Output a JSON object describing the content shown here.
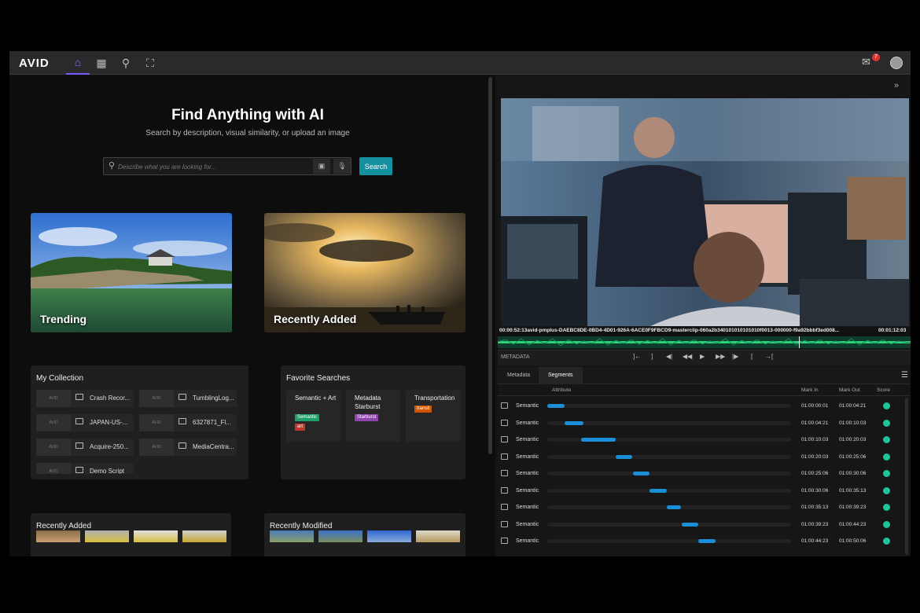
{
  "nav": {
    "logo": "AVID",
    "items": [
      {
        "name": "home",
        "glyph": "⌂"
      },
      {
        "name": "browse",
        "glyph": "▦"
      },
      {
        "name": "search",
        "glyph": "⚲"
      },
      {
        "name": "workflow",
        "glyph": "⛶"
      }
    ],
    "notification_count": "7"
  },
  "hero": {
    "title": "Find Anything with AI",
    "subtitle": "Search by description, visual similarity, or upload an image",
    "search_placeholder": "Describe what you are looking for...",
    "search_label": "Search"
  },
  "tiles": [
    {
      "label": "Trending"
    },
    {
      "label": "Recently Added"
    }
  ],
  "my_collection": {
    "title": "My Collection",
    "items": [
      "Crash Recor...",
      "TumblingLog...",
      "JAPAN-US-...",
      "6327871_Fl...",
      "Acquire-250...",
      "MediaCentra...",
      "Demo Script"
    ]
  },
  "favorite_searches": {
    "title": "Favorite Searches",
    "items": [
      {
        "label": "Semantic + Art",
        "chips": [
          {
            "text": "Semantic",
            "color": "#1f9d6a"
          },
          {
            "text": "art",
            "color": "#c0392b"
          }
        ]
      },
      {
        "label": "Metadata Starburst",
        "chips": [
          {
            "text": "Starburst",
            "color": "#8e44ad"
          }
        ]
      },
      {
        "label": "Transportation",
        "chips": [
          {
            "text": "transit",
            "color": "#d35400"
          }
        ]
      }
    ]
  },
  "recently_added": {
    "title": "Recently Added"
  },
  "recently_modified": {
    "title": "Recently Modified"
  },
  "player": {
    "timecode_start": "00:00:52:13",
    "clip_name": "avid-pmplus-DAEBC8DE-0BD4-4D01-926A-6ACE0F9FBCD9-masterclip-060a2b340101010101010f0013-000000-f9a92bbbf3ed008...",
    "timecode_end": "00:01:12:03",
    "panel_label": "METADATA"
  },
  "tabs": [
    {
      "label": "Metadata"
    },
    {
      "label": "Segments"
    }
  ],
  "segments": {
    "headers": {
      "attribute": "Attribute",
      "mark_in": "Mark In",
      "mark_out": "Mark Out",
      "score": "Score"
    },
    "rows": [
      {
        "type": "Semantic",
        "mark_in": "01:00:00:01",
        "mark_out": "01:00:04:21",
        "start": 0.0,
        "end": 0.07
      },
      {
        "type": "Semantic",
        "mark_in": "01:00:04:21",
        "mark_out": "01:00:10:03",
        "start": 0.07,
        "end": 0.15
      },
      {
        "type": "Semantic",
        "mark_in": "01:00:10:03",
        "mark_out": "01:00:20:03",
        "start": 0.14,
        "end": 0.28
      },
      {
        "type": "Semantic",
        "mark_in": "01:00:20:03",
        "mark_out": "01:00:25:06",
        "start": 0.28,
        "end": 0.35
      },
      {
        "type": "Semantic",
        "mark_in": "01:00:25:06",
        "mark_out": "01:00:30:06",
        "start": 0.35,
        "end": 0.42
      },
      {
        "type": "Semantic",
        "mark_in": "01:00:30:06",
        "mark_out": "01:00:35:13",
        "start": 0.42,
        "end": 0.49
      },
      {
        "type": "Semantic",
        "mark_in": "01:00:35:13",
        "mark_out": "01:00:39:23",
        "start": 0.49,
        "end": 0.55
      },
      {
        "type": "Semantic",
        "mark_in": "01:00:39:23",
        "mark_out": "01:00:44:23",
        "start": 0.55,
        "end": 0.62
      },
      {
        "type": "Semantic",
        "mark_in": "01:00:44:23",
        "mark_out": "01:00:50:06",
        "start": 0.62,
        "end": 0.69
      }
    ]
  }
}
